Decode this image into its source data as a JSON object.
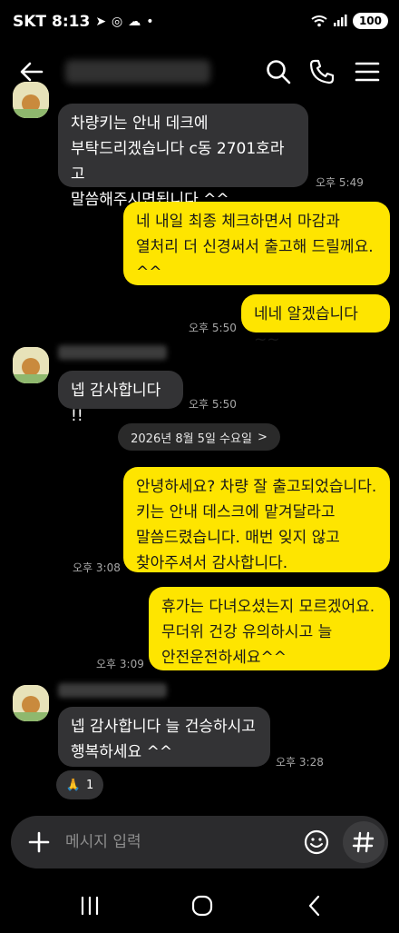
{
  "status_bar": {
    "carrier": "SKT",
    "time": "8:13",
    "battery": "100"
  },
  "header": {
    "chat_title": "•••••••••"
  },
  "messages": [
    {
      "side": "in",
      "text": "차량키는 안내 데크에\n부탁드리겠습니다 c동 2701호라고\n말씀해주시면됩니다 ^^",
      "time": "오후 5:49"
    },
    {
      "side": "out",
      "text": "네 내일 최종 체크하면서 마감과\n열처리 더 신경써서 출고해 드릴께요.\n^^",
      "time": ""
    },
    {
      "side": "out",
      "text": "네네 알겠습니다~~",
      "time": "오후 5:50"
    },
    {
      "side": "in",
      "text": "넵 감사합니다 !!",
      "time": "오후 5:50"
    },
    {
      "side": "out",
      "text": "안녕하세요? 차량 잘 출고되었습니다.\n키는 안내 데스크에 맡겨달라고\n말씀드렸습니다. 매번 잊지 않고\n찾아주셔서 감사합니다.",
      "time": "오후 3:08"
    },
    {
      "side": "out",
      "text": "휴가는 다녀오셨는지 모르겠어요.\n무더위 건강 유의하시고 늘\n안전운전하세요^^",
      "time": "오후 3:09"
    },
    {
      "side": "in",
      "text": "넵 감사합니다 늘 건승하시고\n행복하세요 ^^",
      "time": "오후 3:28"
    }
  ],
  "date_divider": "2026년 8월 5일 수요일",
  "date_divider_arrow": ">",
  "reaction": {
    "emoji": "🙏",
    "count": "1"
  },
  "input": {
    "placeholder": "메시지 입력"
  },
  "colors": {
    "outgoing_bubble": "#fee500",
    "incoming_bubble": "#333335",
    "background": "#000000"
  }
}
